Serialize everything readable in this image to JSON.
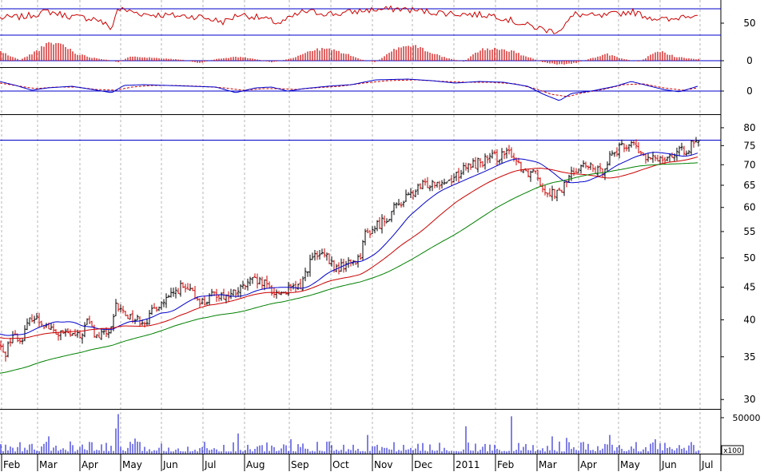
{
  "chart_data": {
    "type": "line",
    "subtype": "stock-technical-chart",
    "x_axis": {
      "month_labels": [
        "Feb",
        "Mar",
        "Apr",
        "May",
        "Jun",
        "Jul",
        "Aug",
        "Sep",
        "Oct",
        "Nov",
        "Dec",
        "2011",
        "Feb",
        "Mar",
        "Apr",
        "May",
        "Jun",
        "Jul"
      ]
    },
    "price_panel": {
      "y_scale": "log",
      "y_ticks": [
        30,
        35,
        40,
        45,
        50,
        55,
        60,
        65,
        70,
        75,
        80
      ],
      "y_range": [
        29,
        84
      ],
      "reference_level": 76.5,
      "anchors": [
        [
          0,
          36.5
        ],
        [
          5,
          35
        ],
        [
          15,
          38
        ],
        [
          25,
          37
        ],
        [
          40,
          40.5
        ],
        [
          55,
          39.5
        ],
        [
          70,
          38
        ],
        [
          85,
          38
        ],
        [
          100,
          37.5
        ],
        [
          110,
          40
        ],
        [
          120,
          37.5
        ],
        [
          140,
          38.5
        ],
        [
          145,
          42
        ],
        [
          155,
          41
        ],
        [
          170,
          40
        ],
        [
          185,
          40
        ],
        [
          195,
          42
        ],
        [
          210,
          43
        ],
        [
          225,
          45
        ],
        [
          240,
          44
        ],
        [
          255,
          42.5
        ],
        [
          270,
          44
        ],
        [
          285,
          43.5
        ],
        [
          300,
          44.5
        ],
        [
          315,
          46
        ],
        [
          330,
          45.5
        ],
        [
          345,
          44
        ],
        [
          360,
          44.5
        ],
        [
          375,
          45
        ],
        [
          390,
          50
        ],
        [
          405,
          50.5
        ],
        [
          420,
          48
        ],
        [
          435,
          49
        ],
        [
          450,
          50
        ],
        [
          455,
          54
        ],
        [
          470,
          56
        ],
        [
          485,
          58
        ],
        [
          500,
          61
        ],
        [
          515,
          63
        ],
        [
          530,
          65
        ],
        [
          545,
          66
        ],
        [
          560,
          66
        ],
        [
          575,
          68
        ],
        [
          590,
          70
        ],
        [
          605,
          71
        ],
        [
          620,
          72
        ],
        [
          632,
          72.5
        ],
        [
          640,
          73
        ],
        [
          650,
          70
        ],
        [
          660,
          68
        ],
        [
          670,
          69
        ],
        [
          680,
          64
        ],
        [
          690,
          63.5
        ],
        [
          700,
          63
        ],
        [
          712,
          67
        ],
        [
          725,
          70
        ],
        [
          740,
          69
        ],
        [
          752,
          68
        ],
        [
          765,
          73
        ],
        [
          780,
          74.5
        ],
        [
          790,
          76
        ],
        [
          800,
          73
        ],
        [
          812,
          71
        ],
        [
          825,
          72
        ],
        [
          840,
          72.5
        ],
        [
          855,
          73.5
        ],
        [
          865,
          75
        ],
        [
          873,
          75.5
        ]
      ],
      "series": [
        {
          "name": "",
          "kind": "price-bars",
          "colors": [
            "#000000",
            "#cc0000"
          ]
        },
        {
          "name": "",
          "kind": "moving-average-short",
          "color": "#0000cc",
          "start": 38,
          "end": 73
        },
        {
          "name": "",
          "kind": "moving-average-medium",
          "color": "#cc0000",
          "start": 37.5,
          "end": 72
        },
        {
          "name": "",
          "kind": "moving-average-long",
          "color": "#008000",
          "start": 33,
          "end": 70.5
        }
      ]
    },
    "volume_panel": {
      "y_ticks": [
        50000
      ],
      "y_range": [
        0,
        60000
      ],
      "unit": "x100",
      "bar_color": "#0000cc",
      "spikes": [
        [
          147,
          55000
        ],
        [
          146,
          35000
        ],
        [
          640,
          52000
        ],
        [
          583,
          38000
        ],
        [
          298,
          28000
        ],
        [
          62,
          24000
        ],
        [
          762,
          26000
        ],
        [
          459,
          26000
        ],
        [
          690,
          24000
        ],
        [
          170,
          21000
        ],
        [
          365,
          20000
        ],
        [
          710,
          22000
        ],
        [
          820,
          20000
        ]
      ]
    },
    "rsi_panel": {
      "y_ticks": [
        50
      ],
      "y_range": [
        0,
        100
      ],
      "upper_line": 70,
      "lower_line": 30,
      "line_color": "#cc0000",
      "anchors": [
        [
          0,
          56
        ],
        [
          30,
          58
        ],
        [
          60,
          66
        ],
        [
          90,
          58
        ],
        [
          120,
          55
        ],
        [
          140,
          40
        ],
        [
          147,
          70
        ],
        [
          180,
          62
        ],
        [
          210,
          60
        ],
        [
          250,
          58
        ],
        [
          280,
          50
        ],
        [
          300,
          62
        ],
        [
          330,
          55
        ],
        [
          350,
          48
        ],
        [
          380,
          66
        ],
        [
          420,
          62
        ],
        [
          460,
          68
        ],
        [
          500,
          70
        ],
        [
          540,
          65
        ],
        [
          580,
          62
        ],
        [
          620,
          60
        ],
        [
          650,
          48
        ],
        [
          670,
          42
        ],
        [
          690,
          36
        ],
        [
          700,
          38
        ],
        [
          720,
          62
        ],
        [
          750,
          58
        ],
        [
          790,
          66
        ],
        [
          810,
          58
        ],
        [
          840,
          52
        ],
        [
          855,
          60
        ],
        [
          873,
          62
        ]
      ]
    },
    "histogram_panel": {
      "y_ticks": [
        0
      ],
      "bar_color": "#cc0000",
      "anchors": [
        [
          0,
          12
        ],
        [
          12,
          6
        ],
        [
          25,
          1
        ],
        [
          35,
          6
        ],
        [
          62,
          22
        ],
        [
          78,
          21
        ],
        [
          95,
          9
        ],
        [
          115,
          4
        ],
        [
          135,
          1
        ],
        [
          148,
          -2
        ],
        [
          165,
          6
        ],
        [
          185,
          4
        ],
        [
          205,
          3
        ],
        [
          230,
          1
        ],
        [
          250,
          -3
        ],
        [
          270,
          2
        ],
        [
          300,
          5
        ],
        [
          320,
          2
        ],
        [
          340,
          -2
        ],
        [
          365,
          3
        ],
        [
          390,
          13
        ],
        [
          410,
          15
        ],
        [
          430,
          10
        ],
        [
          450,
          2
        ],
        [
          470,
          -2
        ],
        [
          500,
          18
        ],
        [
          520,
          19
        ],
        [
          540,
          10
        ],
        [
          560,
          3
        ],
        [
          580,
          -1
        ],
        [
          600,
          13
        ],
        [
          620,
          16
        ],
        [
          640,
          12
        ],
        [
          660,
          5
        ],
        [
          680,
          -2
        ],
        [
          700,
          -5
        ],
        [
          720,
          -3
        ],
        [
          740,
          3
        ],
        [
          760,
          8
        ],
        [
          780,
          2
        ],
        [
          800,
          -1
        ],
        [
          820,
          10
        ],
        [
          830,
          11
        ],
        [
          845,
          5
        ],
        [
          860,
          3
        ],
        [
          873,
          2
        ]
      ]
    },
    "macd_panel": {
      "y_ticks": [
        0
      ],
      "macd_color": "#0000cc",
      "signal_color": "#cc0000",
      "macd_anchors": [
        [
          0,
          12
        ],
        [
          20,
          7
        ],
        [
          40,
          1
        ],
        [
          60,
          4
        ],
        [
          90,
          6
        ],
        [
          115,
          2
        ],
        [
          140,
          -2
        ],
        [
          155,
          7
        ],
        [
          180,
          8
        ],
        [
          210,
          7
        ],
        [
          240,
          6
        ],
        [
          270,
          5
        ],
        [
          295,
          -2
        ],
        [
          320,
          4
        ],
        [
          340,
          5
        ],
        [
          360,
          0
        ],
        [
          380,
          3
        ],
        [
          410,
          6
        ],
        [
          440,
          8
        ],
        [
          470,
          14
        ],
        [
          510,
          15
        ],
        [
          540,
          13
        ],
        [
          570,
          10
        ],
        [
          600,
          12
        ],
        [
          630,
          11
        ],
        [
          660,
          6
        ],
        [
          680,
          -4
        ],
        [
          700,
          -12
        ],
        [
          715,
          -3
        ],
        [
          740,
          0
        ],
        [
          770,
          6
        ],
        [
          790,
          12
        ],
        [
          810,
          7
        ],
        [
          830,
          2
        ],
        [
          850,
          -1
        ],
        [
          873,
          6
        ]
      ],
      "signal_anchors": [
        [
          0,
          10
        ],
        [
          25,
          6
        ],
        [
          45,
          3
        ],
        [
          70,
          5
        ],
        [
          95,
          5
        ],
        [
          120,
          2
        ],
        [
          145,
          1
        ],
        [
          165,
          5
        ],
        [
          190,
          7
        ],
        [
          220,
          7
        ],
        [
          250,
          6
        ],
        [
          280,
          4
        ],
        [
          305,
          1
        ],
        [
          330,
          3
        ],
        [
          350,
          3
        ],
        [
          370,
          2
        ],
        [
          395,
          4
        ],
        [
          425,
          6
        ],
        [
          455,
          10
        ],
        [
          485,
          13
        ],
        [
          520,
          14
        ],
        [
          555,
          12
        ],
        [
          585,
          11
        ],
        [
          615,
          11
        ],
        [
          645,
          9
        ],
        [
          670,
          3
        ],
        [
          690,
          -4
        ],
        [
          710,
          -7
        ],
        [
          730,
          -2
        ],
        [
          755,
          2
        ],
        [
          780,
          8
        ],
        [
          805,
          9
        ],
        [
          830,
          4
        ],
        [
          855,
          1
        ],
        [
          873,
          4
        ]
      ]
    }
  }
}
